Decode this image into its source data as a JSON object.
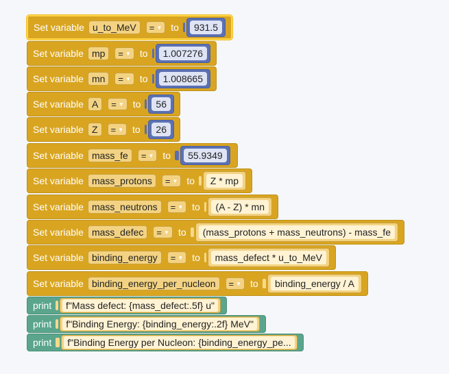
{
  "colors": {
    "variables": "#d9a521",
    "math": "#5b71b3",
    "text": "#5ba58c",
    "selected_outline": "#ffd54a"
  },
  "operator_dropdown_icon": "triangle-down-icon",
  "set_blocks": [
    {
      "keyword": "Set variable",
      "var": "u_to_MeV",
      "op": "=",
      "to": "to",
      "value": "931.5",
      "kind": "number"
    },
    {
      "keyword": "Set variable",
      "var": "mp",
      "op": "=",
      "to": "to",
      "value": "1.007276",
      "kind": "number"
    },
    {
      "keyword": "Set variable",
      "var": "mn",
      "op": "=",
      "to": "to",
      "value": "1.008665",
      "kind": "number"
    },
    {
      "keyword": "Set variable",
      "var": "A",
      "op": "=",
      "to": "to",
      "value": "56",
      "kind": "number"
    },
    {
      "keyword": "Set variable",
      "var": "Z",
      "op": "=",
      "to": "to",
      "value": "26",
      "kind": "number"
    },
    {
      "keyword": "Set variable",
      "var": "mass_fe",
      "op": "=",
      "to": "to",
      "value": "55.9349",
      "kind": "number"
    },
    {
      "keyword": "Set variable",
      "var": "mass_protons",
      "op": "=",
      "to": "to",
      "value": "Z * mp",
      "kind": "expr"
    },
    {
      "keyword": "Set variable",
      "var": "mass_neutrons",
      "op": "=",
      "to": "to",
      "value": "(A - Z) * mn",
      "kind": "expr"
    },
    {
      "keyword": "Set variable",
      "var": "mass_defec",
      "op": "=",
      "to": "to",
      "value": "(mass_protons + mass_neutrons) - mass_fe",
      "kind": "expr"
    },
    {
      "keyword": "Set variable",
      "var": "binding_energy",
      "op": "=",
      "to": "to",
      "value": "mass_defect * u_to_MeV",
      "kind": "expr"
    },
    {
      "keyword": "Set variable",
      "var": "binding_energy_per_nucleon",
      "op": "=",
      "to": "to",
      "value": "binding_energy / A",
      "kind": "expr"
    }
  ],
  "print_blocks": [
    {
      "keyword": "print",
      "text": "f\"Mass defect: {mass_defect:.5f} u\""
    },
    {
      "keyword": "print",
      "text": "f\"Binding Energy: {binding_energy:.2f} MeV\""
    },
    {
      "keyword": "print",
      "text": "f\"Binding Energy per Nucleon: {binding_energy_pe..."
    }
  ]
}
